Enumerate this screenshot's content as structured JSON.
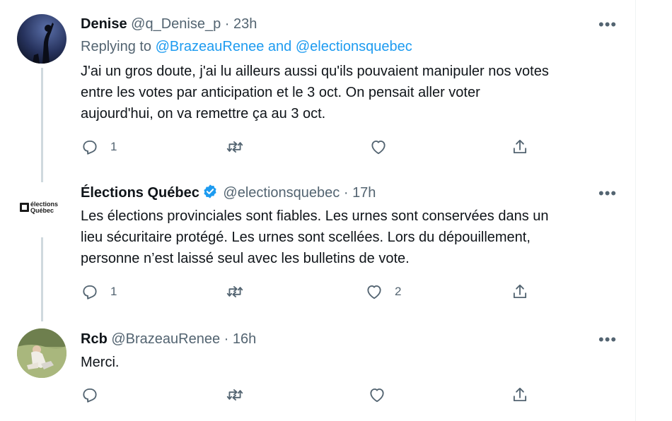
{
  "tweets": [
    {
      "name": "Denise",
      "handle": "@q_Denise_p",
      "sep": "·",
      "time": "23h",
      "replying_prefix": "Replying to ",
      "replying_to": "@BrazeauRenee and @electionsquebec",
      "text": "J'ai un gros doute, j'ai lu ailleurs aussi qu'ils pouvaient manipuler nos votes\nentre les votes par anticipation et le 3 oct. On pensait aller voter\naujourd'hui, on va remettre ça au 3 oct.",
      "reply_count": "1",
      "retweet_count": "",
      "like_count": ""
    },
    {
      "name": "Élections Québec",
      "handle": "@electionsquebec",
      "sep": "·",
      "time": "17h",
      "avatar_logo": "élections Québec",
      "text": "Les élections provinciales sont fiables. Les urnes sont conservées dans un\nlieu sécuritaire protégé. Les urnes sont scellées. Lors du dépouillement,\npersonne n’est laissé seul avec les bulletins de vote.",
      "reply_count": "1",
      "retweet_count": "",
      "like_count": "2"
    },
    {
      "name": "Rcb",
      "handle": "@BrazeauRenee",
      "sep": "·",
      "time": "16h",
      "text": "Merci.",
      "reply_count": "",
      "retweet_count": "",
      "like_count": ""
    }
  ],
  "more_label": "•••",
  "colors": {
    "accent": "#1d9bf0",
    "muted": "#536471",
    "text": "#0f1419",
    "line": "#cfd9de"
  }
}
